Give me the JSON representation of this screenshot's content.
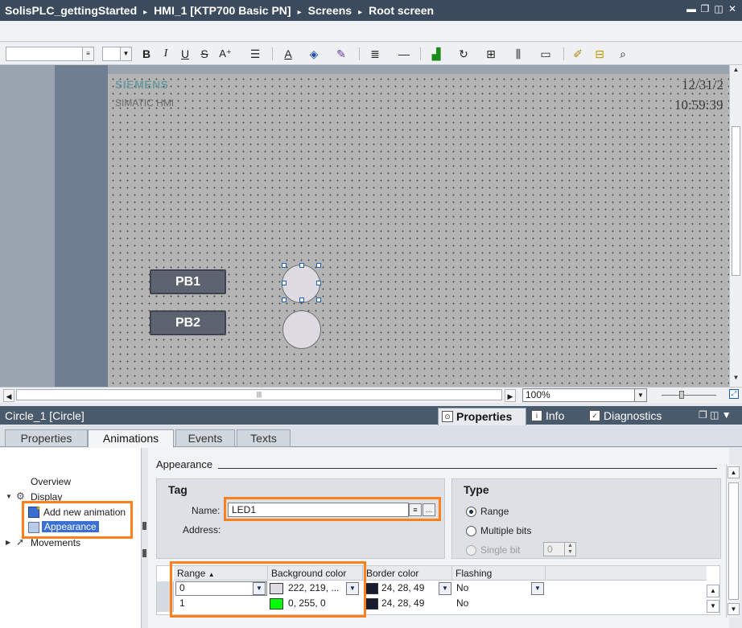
{
  "titlebar": {
    "crumbs": [
      "SolisPLC_gettingStarted",
      "HMI_1 [KTP700 Basic PN]",
      "Screens",
      "Root screen"
    ],
    "separator": "▸"
  },
  "screen": {
    "brand": "SIEMENS",
    "product": "SIMATIC HMI",
    "date": "12/31/2",
    "time": "10:59:39",
    "buttons": [
      "PB1",
      "PB2"
    ]
  },
  "editor_footer": {
    "zoom": "100%"
  },
  "inspector": {
    "object": "Circle_1 [Circle]",
    "tabs": [
      "Properties",
      "Info",
      "Diagnostics"
    ],
    "subtabs": [
      "Properties",
      "Animations",
      "Events",
      "Texts"
    ],
    "tree": {
      "overview": "Overview",
      "display": "Display",
      "add_animation": "Add new animation",
      "appearance": "Appearance",
      "movements": "Movements"
    },
    "section_title": "Appearance",
    "tag": {
      "title": "Tag",
      "name_label": "Name:",
      "name_value": "LED1",
      "address_label": "Address:"
    },
    "type": {
      "title": "Type",
      "options": [
        "Range",
        "Multiple bits",
        "Single bit"
      ],
      "selected": "Range",
      "single_bit_value": "0"
    },
    "table": {
      "headers": [
        "Range",
        "Background color",
        "Border color",
        "Flashing"
      ],
      "rows": [
        {
          "range": "0",
          "bg_color": "222, 219, ...",
          "bg_swatch": "#dedbe3",
          "border_color": "24, 28, 49",
          "border_swatch": "#181c31",
          "flashing": "No"
        },
        {
          "range": "1",
          "bg_color": "0, 255, 0",
          "bg_swatch": "#00ff00",
          "border_color": "24, 28, 49",
          "border_swatch": "#181c31",
          "flashing": "No"
        }
      ]
    }
  },
  "colors": {
    "titlebar": "#3c4a5d",
    "highlight": "#ff7f1a",
    "selection": "#3b6fd1"
  }
}
